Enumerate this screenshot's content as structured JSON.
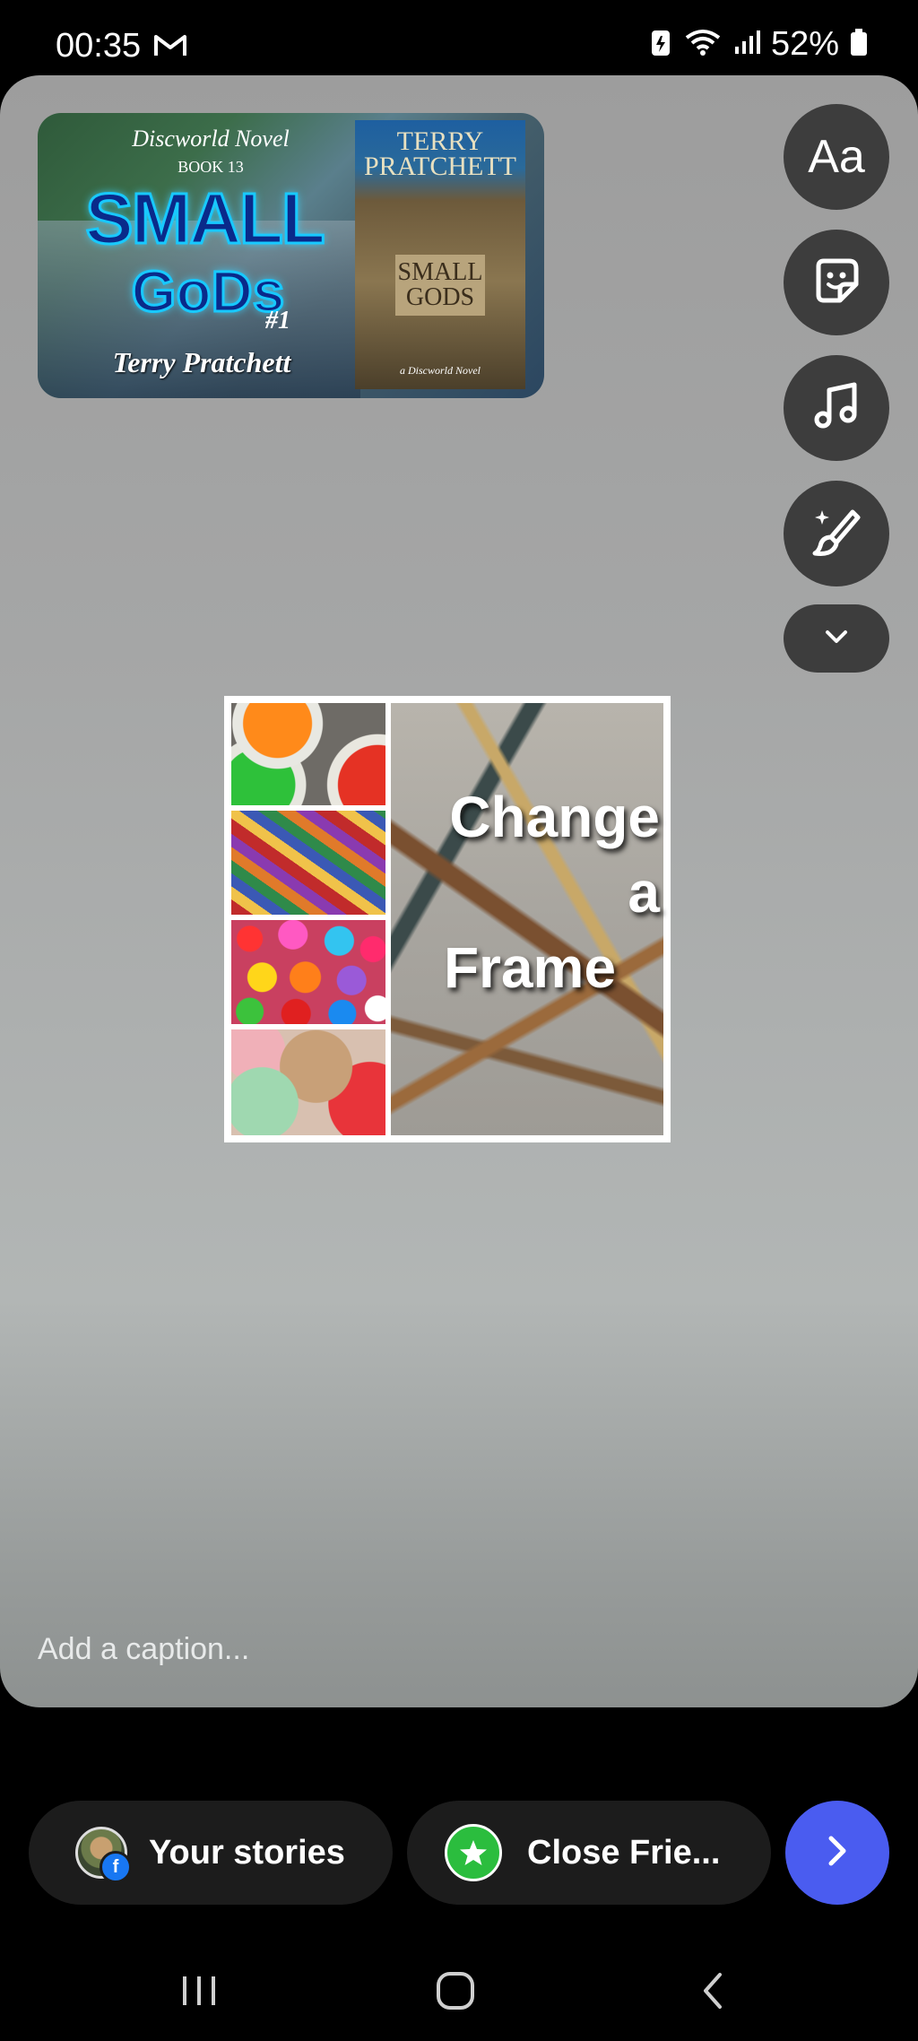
{
  "status_bar": {
    "time": "00:35",
    "battery_percent": "52%"
  },
  "book_card": {
    "series": "Discworld Novel",
    "book_number": "BOOK 13",
    "title_line1": "SMALL",
    "title_line2": "GoDs",
    "number_tag": "#1",
    "author": "Terry Pratchett",
    "cover_author": "TERRY PRATCHETT",
    "cover_title": "SMALL GODS",
    "cover_subtitle": "a Discworld Novel"
  },
  "tools": {
    "text_label": "Aa"
  },
  "collage": {
    "line1": "Change",
    "line2": "a",
    "line3": "Frame"
  },
  "caption": {
    "placeholder": "Add a caption..."
  },
  "share": {
    "your_stories": "Your stories",
    "close_friends": "Close Frie..."
  },
  "colors": {
    "send_button": "#4a5cf0",
    "close_friends_icon": "#2bbd3e",
    "facebook_badge": "#1877f2"
  }
}
